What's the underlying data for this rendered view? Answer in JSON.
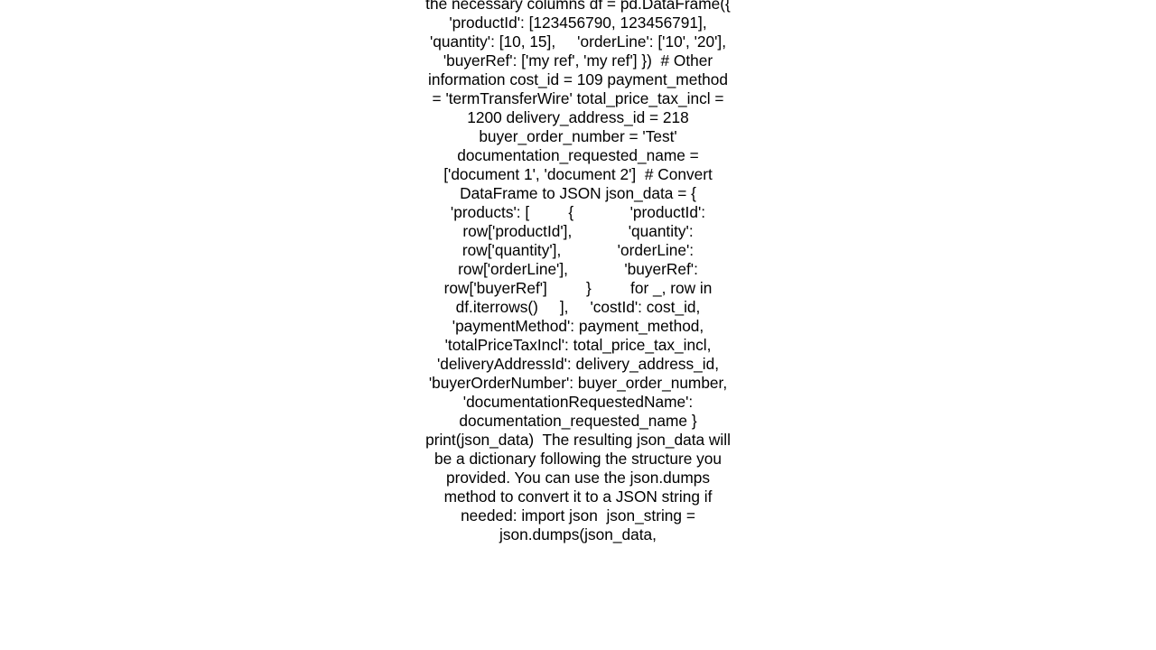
{
  "document": {
    "body_text": "the necessary columns df = pd.DataFrame({     'productId': [123456790, 123456791],     'quantity': [10, 15],     'orderLine': ['10', '20'],     'buyerRef': ['my ref', 'my ref'] })  # Other information cost_id = 109 payment_method = 'termTransferWire' total_price_tax_incl = 1200 delivery_address_id = 218 buyer_order_number = 'Test' documentation_requested_name = ['document 1', 'document 2']  # Convert DataFrame to JSON json_data = {     'products': [         {             'productId': row['productId'],             'quantity': row['quantity'],             'orderLine': row['orderLine'],             'buyerRef': row['buyerRef']         }         for _, row in df.iterrows()     ],     'costId': cost_id,     'paymentMethod': payment_method,     'totalPriceTaxIncl': total_price_tax_incl,     'deliveryAddressId': delivery_address_id,     'buyerOrderNumber': buyer_order_number,     'documentationRequestedName': documentation_requested_name }  print(json_data)  The resulting json_data will be a dictionary following the structure you provided. You can use the json.dumps method to convert it to a JSON string if needed: import json  json_string = json.dumps(json_data,"
  }
}
